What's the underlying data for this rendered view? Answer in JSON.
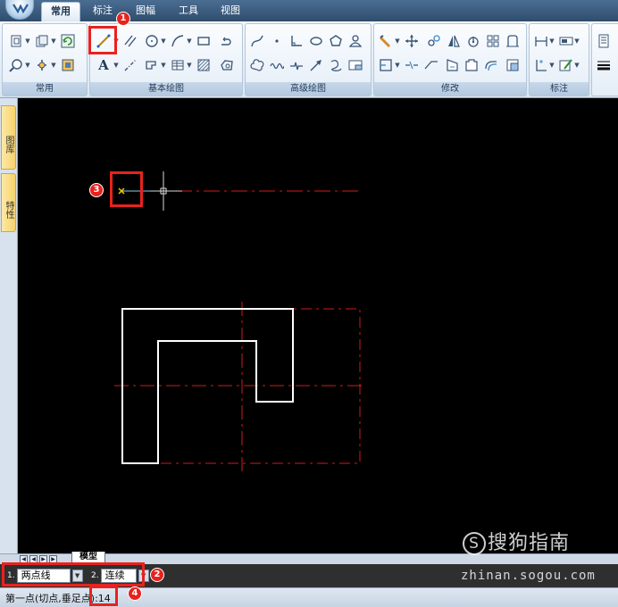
{
  "tabs": [
    {
      "label": "常用",
      "active": true
    },
    {
      "label": "标注",
      "active": false
    },
    {
      "label": "图幅",
      "active": false
    },
    {
      "label": "工具",
      "active": false
    },
    {
      "label": "视图",
      "active": false
    }
  ],
  "ribbon": {
    "groups": [
      {
        "title": "常用"
      },
      {
        "title": "基本绘图"
      },
      {
        "title": "高级绘图"
      },
      {
        "title": "修改"
      },
      {
        "title": "标注"
      }
    ],
    "text_icon": "A"
  },
  "left_panel": {
    "tab1": "图库",
    "tab2": "特性"
  },
  "model_tab": "模型",
  "command_bar": {
    "option1": {
      "num": "1.",
      "value": "两点线"
    },
    "option2": {
      "num": "2.",
      "value": "连续"
    }
  },
  "status": {
    "prompt": "第一点(切点,垂足点):14"
  },
  "badges": [
    "1",
    "2",
    "3",
    "4"
  ],
  "watermark": {
    "brand": "搜狗指南",
    "logo_letter": "S",
    "url": "zhinan.sogou.com"
  },
  "colors": {
    "highlight": "#e8221e",
    "centerline": "#d11a1a",
    "geometry": "#ffffff",
    "canvas_bg": "#000000"
  }
}
